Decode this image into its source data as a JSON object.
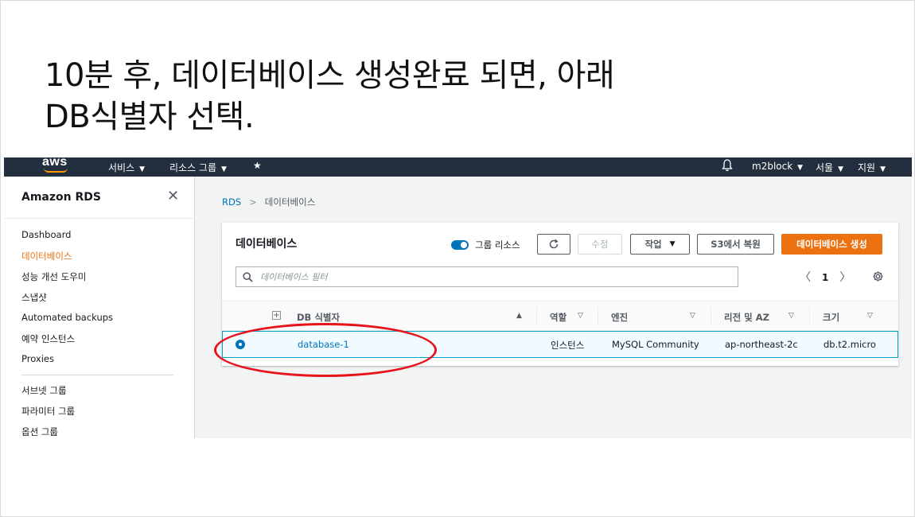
{
  "slide": {
    "title_line1": "10분 후, 데이터베이스 생성완료 되면, 아래",
    "title_line2": "DB식별자 선택."
  },
  "topnav": {
    "logo": "aws",
    "services": "서비스",
    "resource_groups": "리소스 그룹",
    "account": "m2block",
    "region": "서울",
    "support": "지원"
  },
  "sidebar": {
    "title": "Amazon RDS",
    "items": [
      {
        "label": "Dashboard",
        "active": false
      },
      {
        "label": "데이터베이스",
        "active": true
      },
      {
        "label": "성능 개선 도우미",
        "active": false
      },
      {
        "label": "스냅샷",
        "active": false
      },
      {
        "label": "Automated backups",
        "active": false
      },
      {
        "label": "예약 인스턴스",
        "active": false
      },
      {
        "label": "Proxies",
        "active": false
      }
    ],
    "items2": [
      {
        "label": "서브넷 그룹"
      },
      {
        "label": "파라미터 그룹"
      },
      {
        "label": "옵션 그룹"
      }
    ]
  },
  "breadcrumb": {
    "root": "RDS",
    "current": "데이터베이스"
  },
  "panel": {
    "title": "데이터베이스",
    "group_resources_label": "그룹 리소스",
    "modify_label": "수정",
    "actions_label": "작업",
    "restore_s3_label": "S3에서 복원",
    "create_label": "데이터베이스 생성",
    "filter_placeholder": "데이터베이스 필터",
    "page": "1"
  },
  "table": {
    "columns": [
      "DB 식별자",
      "역할",
      "엔진",
      "리전 및 AZ",
      "크기"
    ],
    "rows": [
      {
        "identifier": "database-1",
        "role": "인스턴스",
        "engine": "MySQL Community",
        "region_az": "ap-northeast-2c",
        "size": "db.t2.micro"
      }
    ]
  },
  "colors": {
    "nav_bg": "#232f3e",
    "accent_orange": "#ec7211",
    "link_blue": "#0073bb",
    "annotation_red": "#e6141c"
  }
}
